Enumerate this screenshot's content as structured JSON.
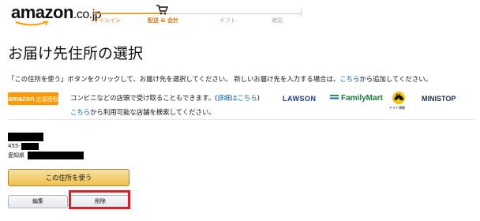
{
  "header": {
    "logo_text": "amazon",
    "logo_suffix": ".co.jp",
    "steps": [
      {
        "label": "サインイン",
        "state": "done"
      },
      {
        "label": "配送 & 会計",
        "state": "current"
      },
      {
        "label": "ギフト",
        "state": "upcoming"
      },
      {
        "label": "確認",
        "state": "upcoming"
      }
    ]
  },
  "page": {
    "title": "お届け先住所の選択",
    "instruction_main": "「この住所を使う」ボタンをクリックして、お届け先を選択してください。 新しいお届け先を入力する場合は、",
    "instruction_link": "こちら",
    "instruction_tail": "から追加してください。"
  },
  "convenience": {
    "badge_brand": "amazon",
    "badge_label": "店頭受取",
    "text_main": "コンビニなどの店頭で受け取ることもできます。(",
    "text_link": "詳細はこちら",
    "text_close": ")",
    "search_link": "こちら",
    "search_tail": "から利用可能な店舗を検索してください。",
    "stores": [
      "LAWSON",
      "FamilyMart",
      "ヤマト運輸",
      "MINISTOP"
    ]
  },
  "address": {
    "postal_prefix": "455-",
    "prefecture": "愛知県"
  },
  "actions": {
    "use_address": "この住所を使う",
    "edit": "編集",
    "delete": "削除"
  },
  "colors": {
    "accent_orange": "#ff9900",
    "link_blue": "#0066c0",
    "highlight_red": "#e31b23"
  }
}
